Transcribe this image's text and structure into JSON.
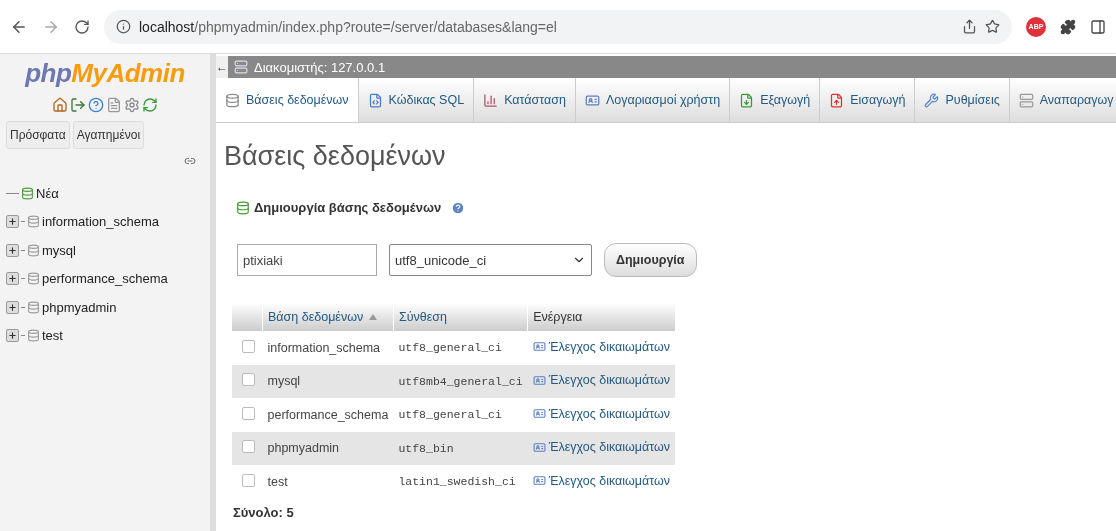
{
  "browser": {
    "url_host": "localhost",
    "url_path": "/phpmyadmin/index.php?route=/server/databases&lang=el",
    "extension_badge": "ABP"
  },
  "sidebar": {
    "logo": {
      "first": "php",
      "second": "MyAdmin"
    },
    "buttons": [
      "Πρόσφατα",
      "Αγαπημένοι"
    ],
    "tree": [
      {
        "label": "Νέα",
        "kind": "new"
      },
      {
        "label": "information_schema",
        "kind": "database",
        "expanded": false
      },
      {
        "label": "mysql",
        "kind": "database",
        "expanded": false
      },
      {
        "label": "performance_schema",
        "kind": "database",
        "expanded": false
      },
      {
        "label": "phpmyadmin",
        "kind": "database",
        "expanded": false
      },
      {
        "label": "test",
        "kind": "database",
        "expanded": false
      }
    ]
  },
  "server_bar": {
    "back": "←",
    "label": "Διακομιστής: 127.0.0.1"
  },
  "tabs": [
    {
      "label": "Βάσεις δεδομένων",
      "selected": true
    },
    {
      "label": "Κώδικας SQL",
      "selected": false
    },
    {
      "label": "Κατάσταση",
      "selected": false
    },
    {
      "label": "Λογαριασμοί χρήστη",
      "selected": false
    },
    {
      "label": "Εξαγωγή",
      "selected": false
    },
    {
      "label": "Εισαγωγή",
      "selected": false
    },
    {
      "label": "Ρυθμίσεις",
      "selected": false
    },
    {
      "label": "Αναπαραγωγ",
      "selected": false
    }
  ],
  "page_title": "Βάσεις δεδομένων",
  "create": {
    "heading": "Δημιουργία βάσης δεδομένων",
    "name_value": "ptixiaki",
    "collation": "utf8_unicode_ci",
    "button": "Δημιουργία"
  },
  "table": {
    "columns": [
      "Βάση δεδομένων",
      "Σύνθεση",
      "Ενέργεια"
    ],
    "rows": [
      {
        "name": "information_schema",
        "collation": "utf8_general_ci",
        "action": "Έλεγχος δικαιωμάτων",
        "checked": false
      },
      {
        "name": "mysql",
        "collation": "utf8mb4_general_ci",
        "action": "Έλεγχος δικαιωμάτων",
        "checked": false
      },
      {
        "name": "performance_schema",
        "collation": "utf8_general_ci",
        "action": "Έλεγχος δικαιωμάτων",
        "checked": false
      },
      {
        "name": "phpmyadmin",
        "collation": "utf8_bin",
        "action": "Έλεγχος δικαιωμάτων",
        "checked": false
      },
      {
        "name": "test",
        "collation": "latin1_swedish_ci",
        "action": "Έλεγχος δικαιωμάτων",
        "checked": false
      }
    ],
    "total": "Σύνολο: 5"
  }
}
